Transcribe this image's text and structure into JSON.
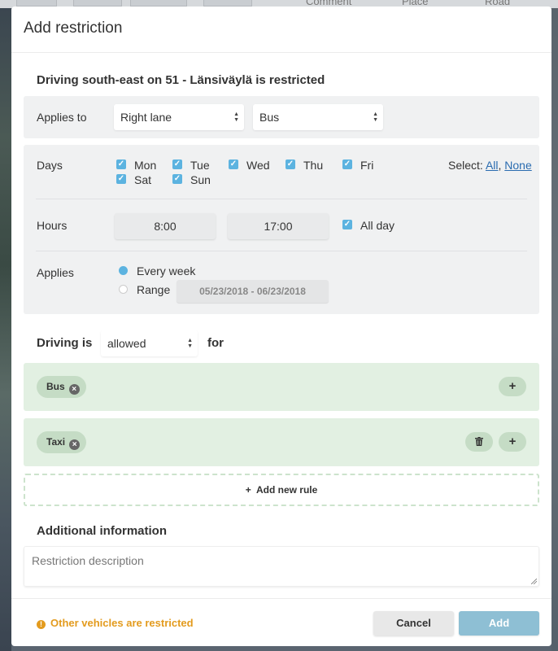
{
  "background": {
    "toolbar_items": [
      "Comment",
      "Place",
      "Road"
    ]
  },
  "dialog": {
    "title": "Add restriction",
    "subtitle": "Driving south-east on 51 - Länsiväylä is restricted"
  },
  "applies_to": {
    "label": "Applies to",
    "lane": "Right lane",
    "vehicle": "Bus"
  },
  "days": {
    "label": "Days",
    "items": [
      {
        "label": "Mon",
        "checked": true
      },
      {
        "label": "Tue",
        "checked": true
      },
      {
        "label": "Wed",
        "checked": true
      },
      {
        "label": "Thu",
        "checked": true
      },
      {
        "label": "Fri",
        "checked": true
      },
      {
        "label": "Sat",
        "checked": true
      },
      {
        "label": "Sun",
        "checked": true
      }
    ],
    "select_label": "Select:",
    "select_all": "All",
    "select_none": "None",
    "separator": ","
  },
  "hours": {
    "label": "Hours",
    "from": "8:00",
    "to": "17:00",
    "all_day_label": "All day",
    "all_day_checked": true
  },
  "applies": {
    "label": "Applies",
    "every_week_label": "Every week",
    "range_label": "Range",
    "selected": "Every week",
    "range_value": "05/23/2018 - 06/23/2018"
  },
  "driving": {
    "prefix": "Driving is",
    "value": "allowed",
    "suffix": "for"
  },
  "rules": [
    {
      "tag": "Bus"
    },
    {
      "tag": "Taxi"
    }
  ],
  "add_rule_label": "Add new rule",
  "additional": {
    "title": "Additional information",
    "placeholder": "Restriction description"
  },
  "footer": {
    "warning": "Other vehicles are restricted",
    "cancel": "Cancel",
    "add": "Add"
  },
  "colors": {
    "accent": "#5cb3e0",
    "rule_bg": "#e2f0e2",
    "warning": "#e39b1e",
    "add_button": "#8ebfd4"
  }
}
